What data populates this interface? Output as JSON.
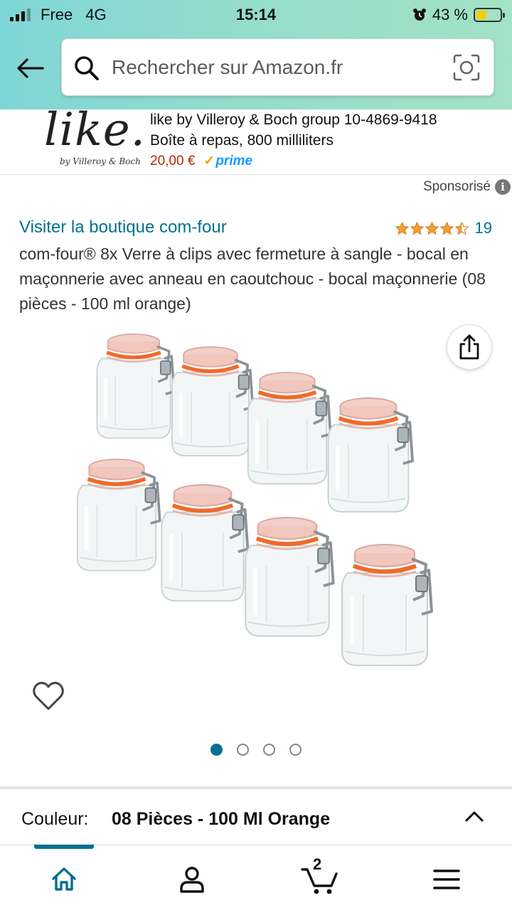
{
  "status_bar": {
    "carrier": "Free",
    "network": "4G",
    "time": "15:14",
    "battery_percent": "43 %",
    "battery_level": 0.43
  },
  "search": {
    "placeholder": "Rechercher sur Amazon.fr"
  },
  "ad": {
    "brand_logo_text": "like.",
    "brand_logo_sub": "by Villeroy & Boch",
    "title": "like by Villeroy & Boch group 10-4869-9418 Boîte à repas, 800 milliliters",
    "price": "20,00 €",
    "prime_label": "prime"
  },
  "sponsored": {
    "label": "Sponsorisé"
  },
  "product": {
    "store_link": "Visiter la boutique com-four",
    "rating_value": 4.5,
    "rating_count": "19",
    "title": "com-four® 8x Verre à clips avec fermeture à sangle - bocal en maçonnerie avec anneau en caoutchouc - bocal maçonnerie (08 pièces - 100 ml orange)",
    "image_count": 4,
    "active_image": 0
  },
  "variant": {
    "label": "Couleur:",
    "value": "08 Pièces - 100 Ml Orange"
  },
  "nav": {
    "cart_count": "2",
    "items": [
      "home-icon",
      "account-icon",
      "cart-icon",
      "menu-icon"
    ]
  },
  "colors": {
    "accent": "#00718f",
    "price": "#b12704",
    "star": "#f0a034",
    "prime": "#1a98ff"
  }
}
